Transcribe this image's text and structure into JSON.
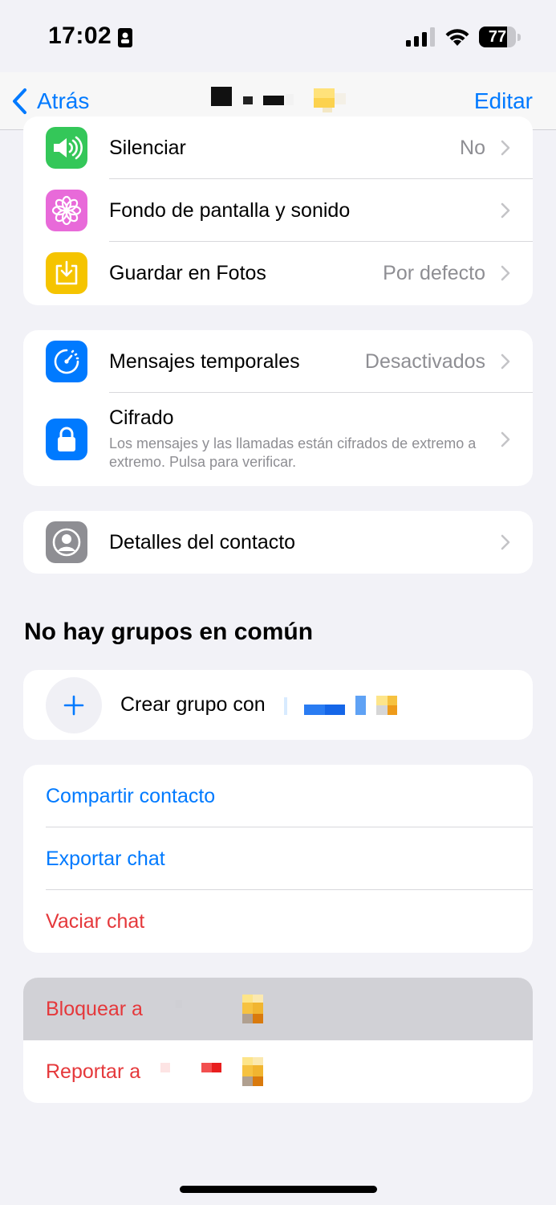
{
  "status_bar": {
    "time": "17:02",
    "battery": "77",
    "battery_level": 0.77
  },
  "nav": {
    "back_label": "Atrás",
    "edit_label": "Editar"
  },
  "settings_card": {
    "rows": [
      {
        "label": "Silenciar",
        "value": "No",
        "icon": "speaker-icon",
        "color": "#34c759"
      },
      {
        "label": "Fondo de pantalla y sonido",
        "value": "",
        "icon": "flower-icon",
        "color": "#e86ad9"
      },
      {
        "label": "Guardar en Fotos",
        "value": "Por defecto",
        "icon": "save-download-icon",
        "color": "#f5c400"
      }
    ]
  },
  "privacy_card": {
    "temporales": {
      "label": "Mensajes temporales",
      "value": "Desactivados",
      "icon": "timer-icon",
      "color": "#007aff"
    },
    "cifrado": {
      "label": "Cifrado",
      "sub": "Los mensajes y las llamadas están cifrados de extremo a extremo. Pulsa para verificar.",
      "icon": "lock-icon",
      "color": "#007aff"
    }
  },
  "contact_card": {
    "label": "Detalles del contacto",
    "icon": "person-circle-icon",
    "color": "#8e8e93"
  },
  "groups": {
    "title": "No hay grupos en común",
    "create_label": "Crear grupo con"
  },
  "actions": {
    "share": "Compartir contacto",
    "export": "Exportar chat",
    "clear": "Vaciar chat"
  },
  "danger": {
    "block": "Bloquear a",
    "report": "Reportar a"
  },
  "colors": {
    "accent": "#007aff",
    "danger": "#e5383b",
    "background": "#f2f2f7",
    "highlight": "#d1d1d6"
  }
}
